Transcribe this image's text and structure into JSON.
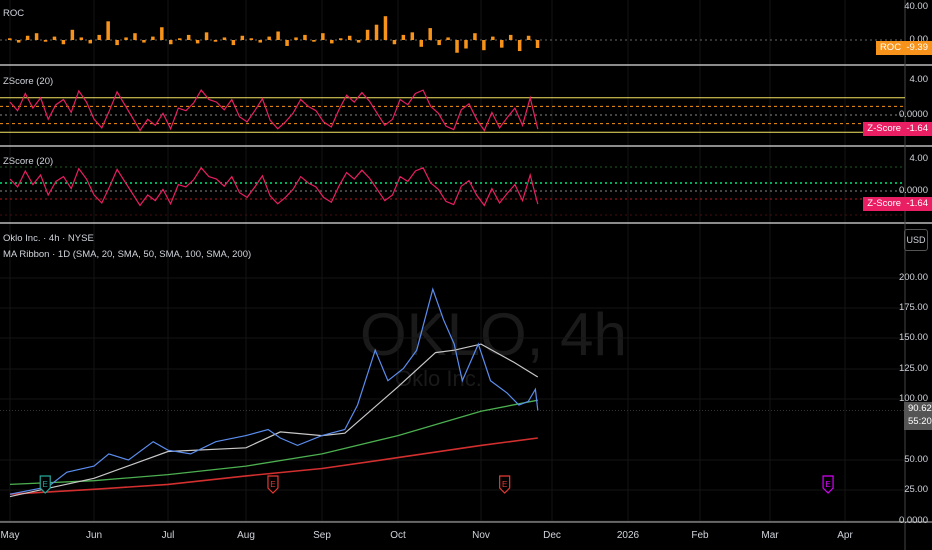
{
  "colors": {
    "roc": "#f7931a",
    "zscore": "#e91e63",
    "sma20": "#c8c8c8",
    "sma50": "#4caf50",
    "sma100": "#d32f2f",
    "price": "#5b8def",
    "earnings_past_green": "#26a69a",
    "earnings_past_red": "#e53935",
    "earnings_future": "#d500f9"
  },
  "panes": {
    "roc": {
      "title": "ROC",
      "axis": [
        "40.00",
        "0.00"
      ],
      "tag_name": "ROC",
      "tag_value": "-9.39"
    },
    "zscore1": {
      "title": "ZScore (20)",
      "axis": [
        "4.00",
        "0.0000"
      ],
      "tag_name": "Z-Score",
      "tag_value": "-1.64"
    },
    "zscore2": {
      "title": "ZScore (20)",
      "axis": [
        "4.00",
        "0.0000"
      ],
      "tag_name": "Z-Score",
      "tag_value": "-1.64"
    },
    "main": {
      "title": "Oklo Inc. · 4h · NYSE",
      "indicator": "MA Ribbon · 1D (SMA, 20, SMA, 50, SMA, 100, SMA, 200)",
      "currency": "USD",
      "watermark_ticker": "OKLO, 4h",
      "watermark_name": "Oklo Inc.",
      "axis": [
        "200.00",
        "175.00",
        "150.00",
        "125.00",
        "100.00",
        "50.00",
        "25.00",
        "0.0000"
      ],
      "last_price": "90.62",
      "countdown": "55:20"
    }
  },
  "time_axis": [
    "May",
    "Jun",
    "Jul",
    "Aug",
    "Sep",
    "Oct",
    "Nov",
    "Dec",
    "2026",
    "Feb",
    "Mar",
    "Apr"
  ],
  "chart_data": [
    {
      "type": "bar",
      "name": "ROC",
      "ylim": [
        -20,
        40
      ],
      "x_range": [
        "2025-05-01",
        "2025-11-25"
      ],
      "values": [
        2,
        -3,
        5,
        8,
        -2,
        4,
        -5,
        12,
        3,
        -4,
        6,
        22,
        -6,
        3,
        8,
        -3,
        4,
        15,
        -5,
        2,
        6,
        -4,
        9,
        -2,
        3,
        -6,
        5,
        2,
        -3,
        4,
        10,
        -7,
        3,
        6,
        -2,
        8,
        -4,
        2,
        5,
        -3,
        12,
        18,
        28,
        -5,
        6,
        9,
        -8,
        14,
        -6,
        3,
        -15,
        -10,
        8,
        -12,
        4,
        -9,
        6,
        -13,
        5,
        -9.39
      ]
    },
    {
      "type": "line",
      "name": "Z-Score",
      "ylim": [
        -3,
        4
      ],
      "x_range": [
        "2025-05-01",
        "2025-11-25"
      ],
      "levels": [
        2,
        1,
        0,
        -1,
        -2
      ],
      "values": [
        1.5,
        0.5,
        2.5,
        0.8,
        2,
        -0.5,
        1.2,
        1.8,
        0.3,
        2.8,
        1.5,
        -0.5,
        -1.5,
        0.5,
        2.7,
        1.2,
        -0.3,
        -1.8,
        -0.5,
        -1.2,
        0.2,
        -1.6,
        0.8,
        0.5,
        1.4,
        2.9,
        1.8,
        1.5,
        0.6,
        1.8,
        -0.2,
        -0.8,
        0.5,
        1.9,
        -0.6,
        -1.6,
        -0.8,
        0.2,
        1.8,
        1.0,
        0.5,
        -0.8,
        -1.4,
        0.6,
        2.3,
        1.5,
        2.6,
        1.6,
        0.2,
        -1.2,
        -0.5,
        1.8,
        1.2,
        2.5,
        2.9,
        1.0,
        0.2,
        -1.3,
        -1.7,
        0.6,
        1.3,
        -0.5,
        -1.8,
        0.3,
        -1.5,
        -0.3,
        0.8,
        -1.2,
        2.0,
        -1.64
      ]
    },
    {
      "type": "line",
      "name": "Oklo Inc. 4h",
      "ylim": [
        0,
        225
      ],
      "x": [
        "2025-05-01",
        "2025-05-15",
        "2025-05-22",
        "2025-06-01",
        "2025-06-07",
        "2025-06-15",
        "2025-06-25",
        "2025-07-01",
        "2025-07-10",
        "2025-07-20",
        "2025-08-01",
        "2025-08-10",
        "2025-08-15",
        "2025-08-22",
        "2025-09-01",
        "2025-09-10",
        "2025-09-15",
        "2025-09-22",
        "2025-09-27",
        "2025-10-03",
        "2025-10-08",
        "2025-10-14",
        "2025-10-18",
        "2025-10-22",
        "2025-10-25",
        "2025-10-31",
        "2025-11-05",
        "2025-11-12",
        "2025-11-17",
        "2025-11-21",
        "2025-11-24",
        "2025-11-25"
      ],
      "values": [
        22,
        28,
        40,
        45,
        55,
        50,
        65,
        58,
        55,
        65,
        70,
        75,
        68,
        62,
        70,
        75,
        95,
        140,
        115,
        125,
        140,
        190,
        165,
        145,
        115,
        145,
        115,
        105,
        95,
        98,
        108,
        90.62
      ]
    },
    {
      "type": "line",
      "name": "SMA 20",
      "x": [
        "2025-05-01",
        "2025-06-01",
        "2025-07-01",
        "2025-08-01",
        "2025-08-15",
        "2025-09-01",
        "2025-09-10",
        "2025-10-01",
        "2025-10-15",
        "2025-10-22",
        "2025-11-01",
        "2025-11-15",
        "2025-11-25"
      ],
      "values": [
        20,
        35,
        57,
        60,
        73,
        70,
        72,
        110,
        138,
        140,
        145,
        130,
        118
      ]
    },
    {
      "type": "line",
      "name": "SMA 50",
      "x": [
        "2025-05-01",
        "2025-06-01",
        "2025-07-01",
        "2025-08-01",
        "2025-09-01",
        "2025-10-01",
        "2025-11-01",
        "2025-11-25"
      ],
      "values": [
        30,
        33,
        38,
        45,
        55,
        70,
        90,
        99
      ]
    },
    {
      "type": "line",
      "name": "SMA 100",
      "x": [
        "2025-05-01",
        "2025-06-01",
        "2025-07-01",
        "2025-08-01",
        "2025-09-01",
        "2025-10-01",
        "2025-11-01",
        "2025-11-25"
      ],
      "values": [
        22,
        26,
        30,
        37,
        43,
        52,
        62,
        68
      ]
    }
  ],
  "events": [
    {
      "label": "E",
      "date": "2025-05-14",
      "kind": "earnings_past_green"
    },
    {
      "label": "E",
      "date": "2025-08-12",
      "kind": "earnings_past_red"
    },
    {
      "label": "E",
      "date": "2025-11-11",
      "kind": "earnings_past_red"
    },
    {
      "label": "E",
      "date": "2026-03-25",
      "kind": "earnings_future"
    }
  ]
}
